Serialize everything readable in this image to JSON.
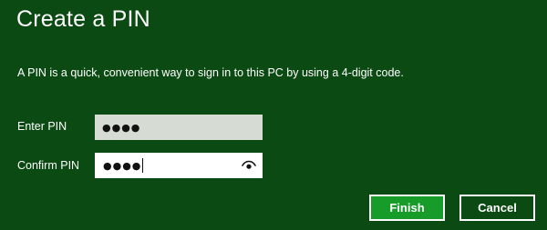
{
  "dialog": {
    "title": "Create a PIN",
    "description": "A PIN is a quick, convenient way to sign in to this PC by using a 4-digit code.",
    "enter_pin": {
      "label": "Enter PIN",
      "value": "●●●●"
    },
    "confirm_pin": {
      "label": "Confirm PIN",
      "value": "●●●●",
      "reveal_icon": "eye-icon"
    },
    "buttons": {
      "finish": "Finish",
      "cancel": "Cancel"
    },
    "colors": {
      "background": "#0b4a12",
      "accent": "#179b29",
      "text": "#ffffff"
    }
  }
}
